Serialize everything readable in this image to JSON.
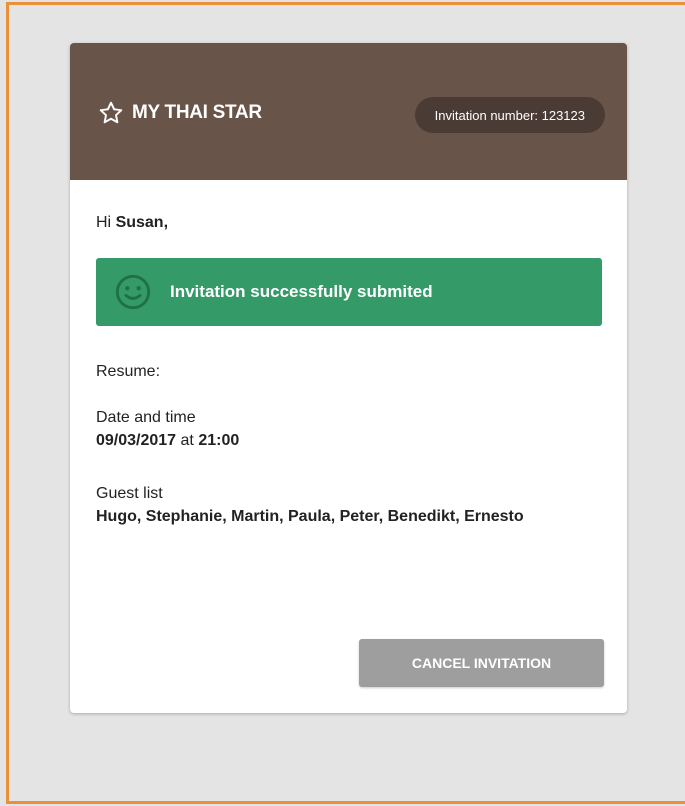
{
  "brand": {
    "name": "MY THAI STAR",
    "icon": "star-outline-icon"
  },
  "invitation": {
    "number_text": "Invitation number: 123123"
  },
  "greeting": {
    "prefix": "Hi ",
    "name": "Susan,"
  },
  "alert": {
    "icon": "smiley-icon",
    "message": "Invitation successfully submited",
    "color": "#349a68"
  },
  "resume": {
    "label": "Resume:"
  },
  "datetime": {
    "label": "Date and time",
    "date": "09/03/2017",
    "connector": " at ",
    "time": "21:00"
  },
  "guests": {
    "label": "Guest list",
    "names": "Hugo, Stephanie, Martin, Paula, Peter, Benedikt, Ernesto"
  },
  "actions": {
    "cancel_label": "CANCEL INVITATION"
  },
  "colors": {
    "header": "#685449",
    "pill": "#4a3c35",
    "frame": "#e8913a",
    "button": "#9e9e9e"
  }
}
